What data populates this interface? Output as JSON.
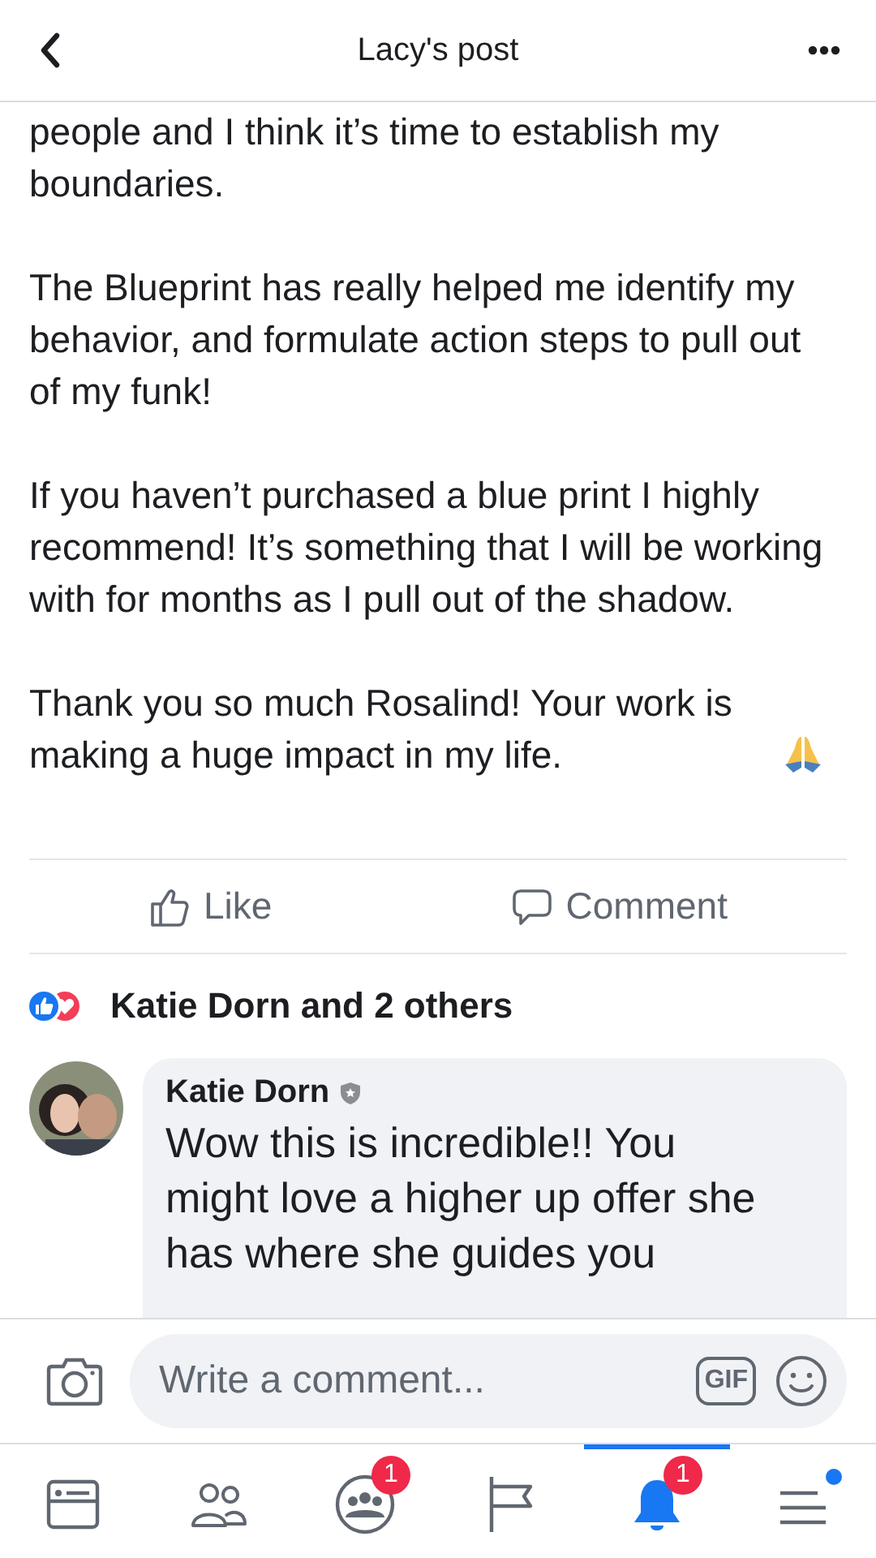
{
  "header": {
    "title": "Lacy's post"
  },
  "post": {
    "paragraphs": [
      "people and I think it’s time to establish my boundaries.",
      "The Blueprint has really helped me identify my behavior, and formulate action steps to pull out of my funk!",
      "If you haven’t purchased a blue print I highly recommend! It’s something that I will be working with for months as I pull out of the shadow.",
      "Thank you so much Rosalind! Your work is making a huge impact in my life."
    ]
  },
  "actions": [
    {
      "kind": "like",
      "label": "Like"
    },
    {
      "kind": "comment",
      "label": "Comment"
    }
  ],
  "reactions": {
    "summary": "Katie Dorn and 2 others"
  },
  "comment": {
    "author": "Katie Dorn",
    "text": "Wow this is incredible!! You might love a higher up offer she has where she guides you"
  },
  "composer": {
    "placeholder": "Write a comment...",
    "gif": "GIF"
  },
  "nav": [
    {
      "kind": "feed",
      "selected": false
    },
    {
      "kind": "friends",
      "selected": false
    },
    {
      "kind": "groups",
      "selected": false,
      "badge": "1"
    },
    {
      "kind": "pages",
      "selected": false
    },
    {
      "kind": "notifications",
      "selected": true,
      "badge": "1"
    },
    {
      "kind": "menu",
      "selected": false,
      "dot": true
    }
  ]
}
